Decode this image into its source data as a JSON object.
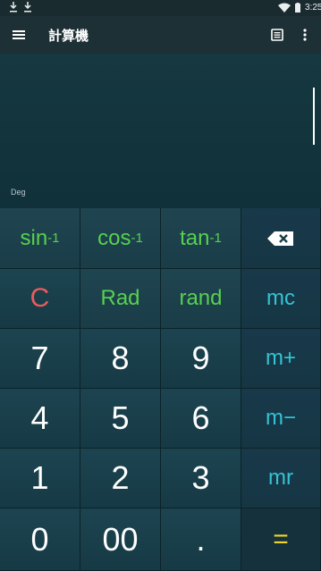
{
  "status_bar": {
    "time": "3:25",
    "icons": [
      "download-icon",
      "download-icon",
      "wifi-icon",
      "battery-icon"
    ]
  },
  "app_bar": {
    "title": "計算機",
    "icons": [
      "menu-icon",
      "history-icon",
      "more-vert-icon"
    ]
  },
  "display": {
    "expression": "",
    "angle_mode": "Deg"
  },
  "keypad": {
    "sci": {
      "asin": {
        "base": "sin",
        "sup": "-1"
      },
      "acos": {
        "base": "cos",
        "sup": "-1"
      },
      "atan": {
        "base": "tan",
        "sup": "-1"
      }
    },
    "clear": "C",
    "rad": "Rad",
    "rand": "rand",
    "mc": "mc",
    "mplus": "m+",
    "mminus": "m−",
    "mr": "mr",
    "digits": {
      "d7": "7",
      "d8": "8",
      "d9": "9",
      "d4": "4",
      "d5": "5",
      "d6": "6",
      "d1": "1",
      "d2": "2",
      "d3": "3",
      "d0": "0",
      "d00": "00"
    },
    "dot": ".",
    "equals": "="
  },
  "colors": {
    "sci_text": "#57d14f",
    "memory_text": "#33c4d4",
    "clear_text": "#ec5b5b",
    "equals_text": "#f1d42a",
    "background": "#123038"
  }
}
